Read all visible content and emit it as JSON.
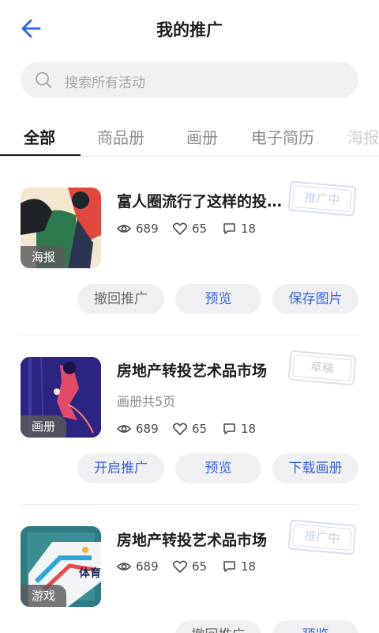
{
  "nav": {
    "title": "我的推广"
  },
  "search": {
    "placeholder": "搜索所有活动"
  },
  "tabs": [
    {
      "label": "全部",
      "active": true
    },
    {
      "label": "商品册"
    },
    {
      "label": "画册"
    },
    {
      "label": "电子简历"
    },
    {
      "label": "海报"
    }
  ],
  "items": [
    {
      "type_badge": "海报",
      "title": "富人圈流行了这样的投…",
      "views": "689",
      "likes": "65",
      "comments": "18",
      "status": "推广中",
      "actions": [
        "撤回推广",
        "预览",
        "保存图片"
      ]
    },
    {
      "type_badge": "画册",
      "title": "房地产转投艺术品市场",
      "subtitle": "画册共5页",
      "views": "689",
      "likes": "65",
      "comments": "18",
      "status": "草稿",
      "actions": [
        "开启推广",
        "预览",
        "下载画册"
      ]
    },
    {
      "type_badge": "游戏",
      "title": "房地产转投艺术品市场",
      "views": "689",
      "likes": "65",
      "comments": "18",
      "status": "推广中",
      "actions": [
        "撤回推广",
        "预览"
      ]
    }
  ],
  "colors": {
    "accent": "#3a63d8",
    "back_arrow": "#2d6bdc"
  }
}
